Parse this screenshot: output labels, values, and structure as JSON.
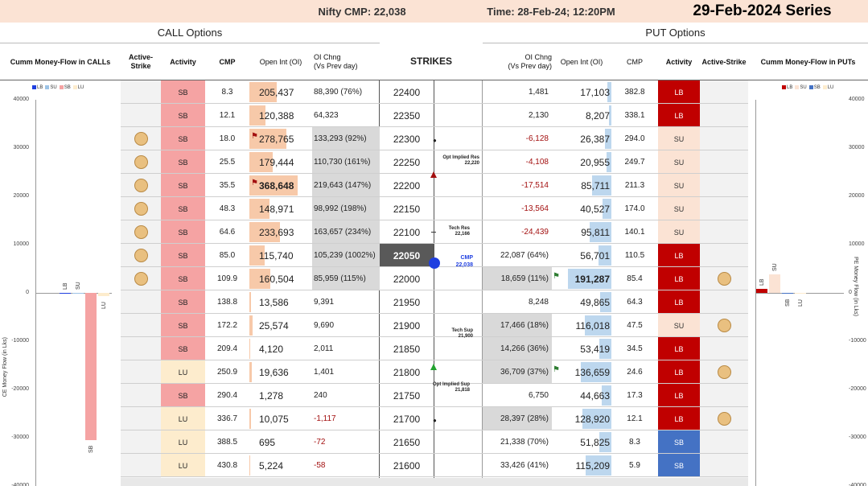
{
  "header": {
    "cmp": "Nifty CMP: 22,038",
    "time": "Time: 28-Feb-24; 12:20PM",
    "series": "29-Feb-2024 Series"
  },
  "call_section": "CALL Options",
  "put_section": "PUT Options",
  "col_headers": {
    "ce_flow": "Cumm Money-Flow in CALLs",
    "active_strike_ce": "Active-Strike",
    "activity_ce": "Activity",
    "cmp_ce": "CMP",
    "oi_ce": "Open Int (OI)",
    "oi_chng_ce": "OI Chng",
    "oi_chng_ce_sub": "(Vs Prev day)",
    "strikes": "STRIKES",
    "oi_chng_pe": "OI Chng",
    "oi_chng_pe_sub": "(Vs Prev day)",
    "oi_pe": "Open Int (OI)",
    "cmp_pe": "CMP",
    "activity_pe": "Activity",
    "active_strike_pe": "Active-Strike",
    "pe_flow": "Cumm Money-Flow in PUTs"
  },
  "colors": {
    "SB": "#f5a3a3",
    "LU": "#fdeccd",
    "LB": "#c00000",
    "SU": "#fbe3d4",
    "PE_SB": "#4472c4",
    "oi_bar_ce": "#f7c9a9",
    "oi_bar_pe": "#bdd7ee",
    "chng_bar": "#d9d9d9",
    "cmp_strike": "#595959",
    "cmp_dot": "#1f3fe0"
  },
  "rows": [
    {
      "strike": "22400",
      "ce_active": false,
      "ce_activity": "SB",
      "ce_cmp": "8.3",
      "ce_oi": "205,437",
      "ce_oi_frac": 0.56,
      "ce_chng": "88,390 (76%)",
      "ce_chng_frac": 0,
      "pe_chng": "1,481",
      "pe_chng_neg": false,
      "pe_chng_frac": 0,
      "pe_oi": "17,103",
      "pe_oi_frac": 0.09,
      "pe_cmp": "382.8",
      "pe_activity": "LB",
      "pe_active": false
    },
    {
      "strike": "22350",
      "ce_active": false,
      "ce_activity": "SB",
      "ce_cmp": "12.1",
      "ce_oi": "120,388",
      "ce_oi_frac": 0.33,
      "ce_chng": "64,323",
      "ce_chng_frac": 0,
      "pe_chng": "2,130",
      "pe_chng_neg": false,
      "pe_chng_frac": 0,
      "pe_oi": "8,207",
      "pe_oi_frac": 0.04,
      "pe_cmp": "338.1",
      "pe_activity": "LB",
      "pe_active": false
    },
    {
      "strike": "22300",
      "ce_active": true,
      "ce_activity": "SB",
      "ce_cmp": "18.0",
      "ce_oi": "278,765",
      "ce_oi_frac": 0.76,
      "ce_flag": true,
      "ce_chng": "133,293 (92%)",
      "ce_chng_frac": 1.0,
      "pe_chng": "-6,128",
      "pe_chng_neg": true,
      "pe_chng_frac": 0,
      "pe_oi": "26,387",
      "pe_oi_frac": 0.14,
      "pe_cmp": "294.0",
      "pe_activity": "SU",
      "pe_active": false
    },
    {
      "strike": "22250",
      "ce_active": true,
      "ce_activity": "SB",
      "ce_cmp": "25.5",
      "ce_oi": "179,444",
      "ce_oi_frac": 0.49,
      "ce_chng": "110,730 (161%)",
      "ce_chng_frac": 1.0,
      "pe_chng": "-4,108",
      "pe_chng_neg": true,
      "pe_chng_frac": 0,
      "pe_oi": "20,955",
      "pe_oi_frac": 0.11,
      "pe_cmp": "249.7",
      "pe_activity": "SU",
      "pe_active": false
    },
    {
      "strike": "22200",
      "ce_active": true,
      "ce_activity": "SB",
      "ce_cmp": "35.5",
      "ce_oi": "368,648",
      "ce_oi_frac": 1.0,
      "ce_flag": true,
      "ce_bold": true,
      "ce_chng": "219,643 (147%)",
      "ce_chng_frac": 1.0,
      "pe_chng": "-17,514",
      "pe_chng_neg": true,
      "pe_chng_frac": 0,
      "pe_oi": "85,711",
      "pe_oi_frac": 0.45,
      "pe_cmp": "211.3",
      "pe_activity": "SU",
      "pe_active": false
    },
    {
      "strike": "22150",
      "ce_active": true,
      "ce_activity": "SB",
      "ce_cmp": "48.3",
      "ce_oi": "148,971",
      "ce_oi_frac": 0.41,
      "ce_chng": "98,992 (198%)",
      "ce_chng_frac": 1.0,
      "pe_chng": "-13,564",
      "pe_chng_neg": true,
      "pe_chng_frac": 0,
      "pe_oi": "40,527",
      "pe_oi_frac": 0.21,
      "pe_cmp": "174.0",
      "pe_activity": "SU",
      "pe_active": false
    },
    {
      "strike": "22100",
      "ce_active": true,
      "ce_activity": "SB",
      "ce_cmp": "64.6",
      "ce_oi": "233,693",
      "ce_oi_frac": 0.64,
      "ce_chng": "163,657 (234%)",
      "ce_chng_frac": 1.0,
      "pe_chng": "-24,439",
      "pe_chng_neg": true,
      "pe_chng_frac": 0,
      "pe_oi": "95,811",
      "pe_oi_frac": 0.5,
      "pe_cmp": "140.1",
      "pe_activity": "SU",
      "pe_active": false
    },
    {
      "strike": "22050",
      "ce_active": true,
      "ce_activity": "SB",
      "ce_cmp": "85.0",
      "ce_oi": "115,740",
      "ce_oi_frac": 0.31,
      "ce_chng": "105,239 (1002%)",
      "ce_chng_frac": 1.0,
      "pe_chng": "22,087 (64%)",
      "pe_chng_neg": false,
      "pe_chng_frac": 0,
      "pe_oi": "56,701",
      "pe_oi_frac": 0.3,
      "pe_cmp": "110.5",
      "pe_activity": "LB",
      "pe_active": false,
      "cmp_row": true
    },
    {
      "strike": "22000",
      "ce_active": true,
      "ce_activity": "SB",
      "ce_cmp": "109.9",
      "ce_oi": "160,504",
      "ce_oi_frac": 0.44,
      "ce_chng": "85,959 (115%)",
      "ce_chng_frac": 1.0,
      "pe_chng": "18,659 (11%)",
      "pe_chng_neg": false,
      "pe_chng_frac": 1.0,
      "pe_flag": true,
      "pe_oi": "191,287",
      "pe_oi_frac": 1.0,
      "pe_bold": true,
      "pe_cmp": "85.4",
      "pe_activity": "LB",
      "pe_active": true
    },
    {
      "strike": "21950",
      "ce_active": false,
      "ce_activity": "SB",
      "ce_cmp": "138.8",
      "ce_oi": "13,586",
      "ce_oi_frac": 0.04,
      "ce_chng": "9,391",
      "ce_chng_frac": 0,
      "pe_chng": "8,248",
      "pe_chng_neg": false,
      "pe_chng_frac": 0,
      "pe_oi": "49,865",
      "pe_oi_frac": 0.26,
      "pe_cmp": "64.3",
      "pe_activity": "LB",
      "pe_active": false
    },
    {
      "strike": "21900",
      "ce_active": false,
      "ce_activity": "SB",
      "ce_cmp": "172.2",
      "ce_oi": "25,574",
      "ce_oi_frac": 0.07,
      "ce_chng": "9,690",
      "ce_chng_frac": 0,
      "pe_chng": "17,466 (18%)",
      "pe_chng_neg": false,
      "pe_chng_frac": 1.0,
      "pe_oi": "116,018",
      "pe_oi_frac": 0.61,
      "pe_cmp": "47.5",
      "pe_activity": "SU",
      "pe_active": true
    },
    {
      "strike": "21850",
      "ce_active": false,
      "ce_activity": "SB",
      "ce_cmp": "209.4",
      "ce_oi": "4,120",
      "ce_oi_frac": 0.01,
      "ce_chng": "2,011",
      "ce_chng_frac": 0,
      "pe_chng": "14,266 (36%)",
      "pe_chng_neg": false,
      "pe_chng_frac": 1.0,
      "pe_oi": "53,419",
      "pe_oi_frac": 0.28,
      "pe_cmp": "34.5",
      "pe_activity": "LB",
      "pe_active": false
    },
    {
      "strike": "21800",
      "ce_active": false,
      "ce_activity": "LU",
      "ce_cmp": "250.9",
      "ce_oi": "19,636",
      "ce_oi_frac": 0.05,
      "ce_chng": "1,401",
      "ce_chng_frac": 0,
      "pe_chng": "36,709 (37%)",
      "pe_chng_neg": false,
      "pe_chng_frac": 1.0,
      "pe_flag": true,
      "pe_oi": "136,659",
      "pe_oi_frac": 0.71,
      "pe_cmp": "24.6",
      "pe_activity": "LB",
      "pe_active": true
    },
    {
      "strike": "21750",
      "ce_active": false,
      "ce_activity": "SB",
      "ce_cmp": "290.4",
      "ce_oi": "1,278",
      "ce_oi_frac": 0.0,
      "ce_chng": "240",
      "ce_chng_frac": 0,
      "pe_chng": "6,750",
      "pe_chng_neg": false,
      "pe_chng_frac": 0,
      "pe_oi": "44,663",
      "pe_oi_frac": 0.23,
      "pe_cmp": "17.3",
      "pe_activity": "LB",
      "pe_active": false
    },
    {
      "strike": "21700",
      "ce_active": false,
      "ce_activity": "LU",
      "ce_cmp": "336.7",
      "ce_oi": "10,075",
      "ce_oi_frac": 0.03,
      "ce_chng": "-1,117",
      "ce_chng_neg": true,
      "ce_chng_frac": 0,
      "pe_chng": "28,397 (28%)",
      "pe_chng_neg": false,
      "pe_chng_frac": 1.0,
      "pe_oi": "128,920",
      "pe_oi_frac": 0.67,
      "pe_cmp": "12.1",
      "pe_activity": "LB",
      "pe_active": true
    },
    {
      "strike": "21650",
      "ce_active": false,
      "ce_activity": "LU",
      "ce_cmp": "388.5",
      "ce_oi": "695",
      "ce_oi_frac": 0.0,
      "ce_chng": "-72",
      "ce_chng_neg": true,
      "ce_chng_frac": 0,
      "pe_chng": "21,338 (70%)",
      "pe_chng_neg": false,
      "pe_chng_frac": 0,
      "pe_oi": "51,825",
      "pe_oi_frac": 0.27,
      "pe_cmp": "8.3",
      "pe_activity": "SB",
      "pe_active": false
    },
    {
      "strike": "21600",
      "ce_active": false,
      "ce_activity": "LU",
      "ce_cmp": "430.8",
      "ce_oi": "5,224",
      "ce_oi_frac": 0.01,
      "ce_chng": "-58",
      "ce_chng_neg": true,
      "ce_chng_frac": 0,
      "pe_chng": "33,426 (41%)",
      "pe_chng_neg": false,
      "pe_chng_frac": 0,
      "pe_oi": "115,209",
      "pe_oi_frac": 0.6,
      "pe_cmp": "5.9",
      "pe_activity": "SB",
      "pe_active": false
    }
  ],
  "annotations": {
    "opt_res": "Opt Implied Res",
    "opt_res_val": "22,220",
    "tech_res": "Tech Res",
    "tech_res_val": "22,166",
    "cmp_label": "CMP",
    "cmp_val": "22,038",
    "tech_sup": "Tech Sup",
    "tech_sup_val": "21,900",
    "opt_sup": "Opt Implied Sup",
    "opt_sup_val": "21,818"
  },
  "chart_data": [
    {
      "type": "bar",
      "title": "",
      "ylabel": "CE Money Flow (in Lks)",
      "ylim": [
        -40000,
        40000
      ],
      "yticks": [
        "40000",
        "30000",
        "20000",
        "10000",
        "0",
        "-10000",
        "-20000",
        "-30000",
        "-40000"
      ],
      "legend": [
        "LB",
        "SU",
        "SB",
        "LU"
      ],
      "categories": [
        "LB",
        "SU",
        "SB",
        "LU"
      ],
      "values": [
        0,
        0,
        -30500,
        -700
      ],
      "colors": [
        "#1f3fe0",
        "#9dc3e6",
        "#f5a3a3",
        "#fdeccd"
      ]
    },
    {
      "type": "bar",
      "title": "",
      "ylabel": "PE Money Flow (in Lks)",
      "ylim": [
        -40000,
        40000
      ],
      "yticks": [
        "40000",
        "30000",
        "20000",
        "10000",
        "0",
        "-10000",
        "-20000",
        "-30000",
        "-40000"
      ],
      "legend": [
        "LB",
        "SU",
        "SB",
        "LU"
      ],
      "categories": [
        "LB",
        "SU",
        "SB",
        "LU"
      ],
      "values": [
        900,
        3800,
        -150,
        -80
      ],
      "colors": [
        "#c00000",
        "#fbe3d4",
        "#4472c4",
        "#fdeccd"
      ]
    }
  ]
}
